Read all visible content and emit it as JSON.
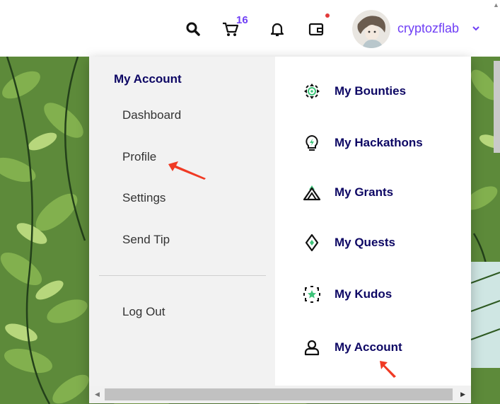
{
  "navbar": {
    "cart_count": "16",
    "username": "cryptozflab",
    "icons": [
      "search-icon",
      "cart-icon",
      "bell-icon",
      "wallet-icon",
      "chevron-down-icon"
    ]
  },
  "dropdown": {
    "section_title": "My Account",
    "account_links": [
      "Dashboard",
      "Profile",
      "Settings",
      "Send Tip"
    ],
    "logout_label": "Log Out",
    "right_items": [
      {
        "label": "My Bounties",
        "icon": "target-icon"
      },
      {
        "label": "My Hackathons",
        "icon": "lightbulb-icon"
      },
      {
        "label": "My Grants",
        "icon": "mountain-icon"
      },
      {
        "label": "My Quests",
        "icon": "diamond-icon"
      },
      {
        "label": "My Kudos",
        "icon": "star-icon"
      },
      {
        "label": "My Account",
        "icon": "user-icon"
      }
    ]
  },
  "colors": {
    "accent": "#6f3ff5",
    "heading": "#0d0764",
    "annotation": "#f03a24",
    "notification_dot": "#e23b3b",
    "icon_green": "#3ec47a"
  }
}
